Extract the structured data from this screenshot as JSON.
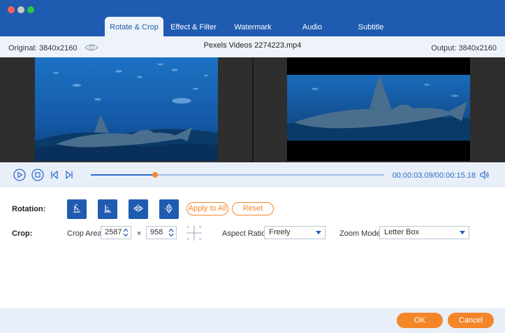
{
  "window": {
    "traffic_lights": [
      "close",
      "minimize",
      "maximize"
    ]
  },
  "tabs": [
    {
      "label": "Rotate & Crop",
      "active": true
    },
    {
      "label": "Effect & Filter",
      "active": false
    },
    {
      "label": "Watermark",
      "active": false
    },
    {
      "label": "Audio",
      "active": false
    },
    {
      "label": "Subtitle",
      "active": false
    }
  ],
  "info": {
    "original": "Original: 3840x2160",
    "filename": "Pexels Videos 2274223.mp4",
    "output": "Output: 3840x2160"
  },
  "player": {
    "current_time": "00:00:03.09",
    "separator": "/",
    "total_time": "00:00:15.18",
    "progress": 0.22
  },
  "rotation": {
    "label": "Rotation:",
    "apply_all": "Apply to All",
    "reset": "Reset"
  },
  "crop": {
    "label": "Crop:",
    "area_label": "Crop Area:",
    "width": "2587",
    "times": "×",
    "height": "958",
    "aspect_label": "Aspect Ratio:",
    "aspect_value": "Freely",
    "zoom_label": "Zoom Mode:",
    "zoom_value": "Letter Box"
  },
  "footer": {
    "ok": "OK",
    "cancel": "Cancel"
  },
  "colors": {
    "brand_blue": "#1f5bb0",
    "accent_orange": "#f4862a"
  }
}
